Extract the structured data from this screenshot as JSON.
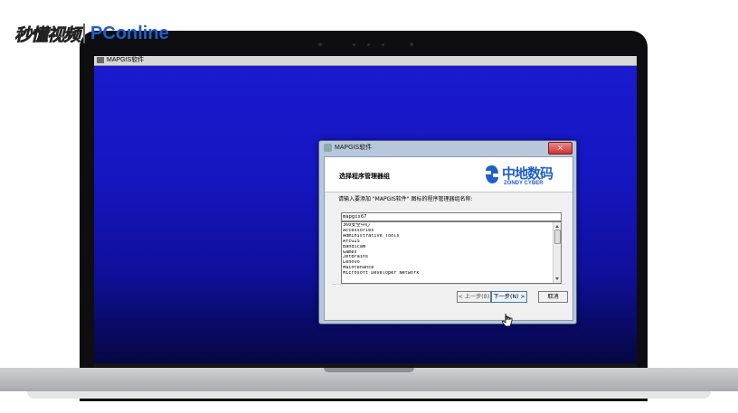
{
  "watermark": {
    "left_text": "秒懂视频",
    "brand_pc": "PC",
    "brand_online": "online"
  },
  "installer_window": {
    "title": "MAPGIS软件"
  },
  "dialog": {
    "title": "MAPGIS软件",
    "close_label": "×",
    "heading": "选择程序管理器组",
    "logo_cn": "中地数码",
    "logo_en": "ZONDY CYBER",
    "prompt": "请输入要添加 \"MAPGIS软件\" 图标的程序管理器组名称:",
    "input_value": "mapgis67",
    "list_items": [
      "360安全中心",
      "Accessories",
      "Administrative Tools",
      "ArcGIS",
      "Bandicam",
      "Games",
      "JetBrains",
      "Lenovo",
      "Maintenance",
      "Microsoft Developer Network"
    ],
    "buttons": {
      "back": "< 上一步(B)",
      "next": "下一步(N) >",
      "cancel": "取消"
    }
  },
  "colors": {
    "desktop_blue": "#1616c2",
    "brand_blue": "#1f5fc9",
    "close_red": "#c33333"
  }
}
